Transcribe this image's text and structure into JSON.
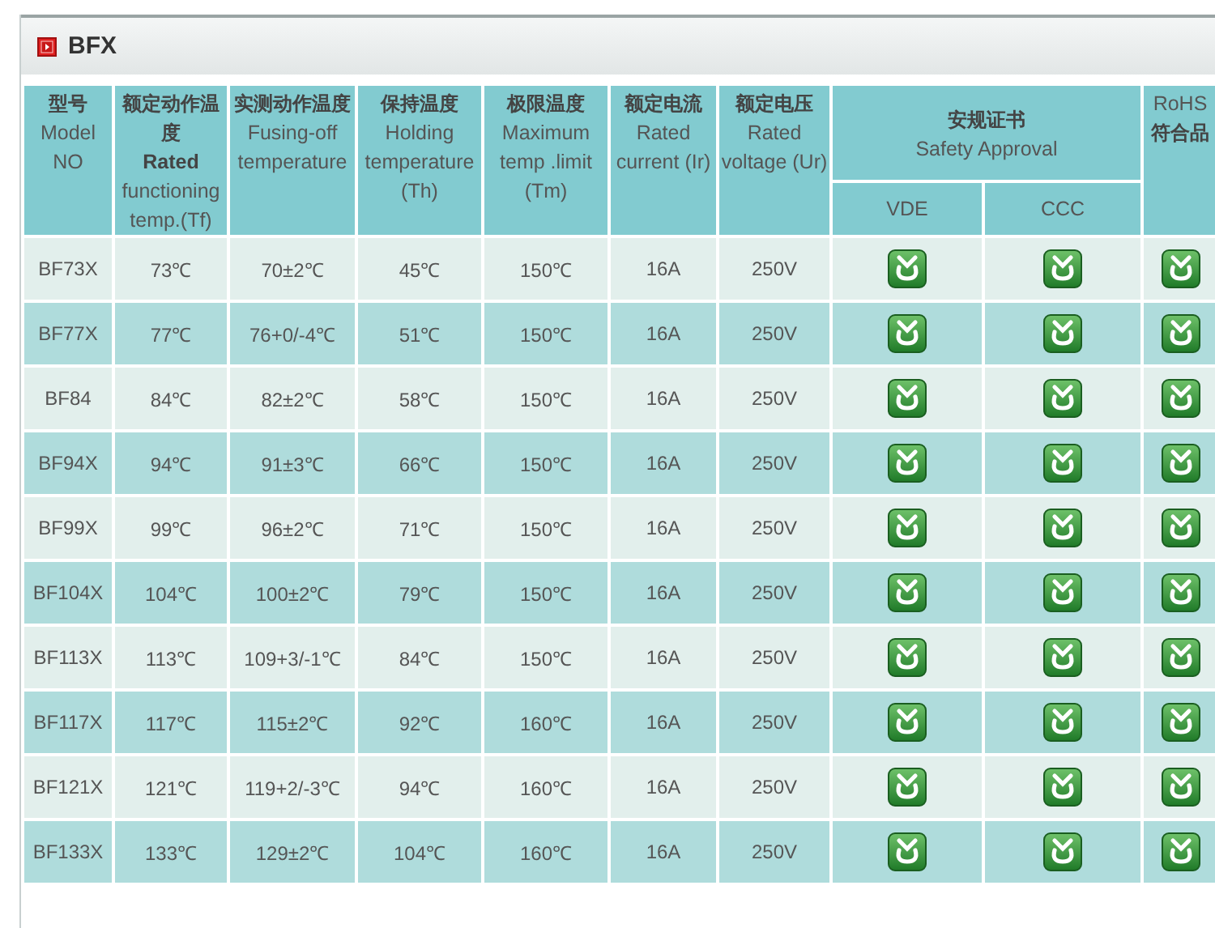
{
  "section": {
    "title": "BFX"
  },
  "columns": [
    {
      "zh": "型号",
      "en": "Model NO"
    },
    {
      "zh": "额定动作温度",
      "en": "**Rated** functioning temp.(Tf)"
    },
    {
      "zh": "实测动作温度",
      "en": "Fusing-off temperature"
    },
    {
      "zh": "保持温度",
      "en": "Holding temperature (Th)"
    },
    {
      "zh": "极限温度",
      "en": "Maximum temp .limit (Tm)"
    },
    {
      "zh": "额定电流",
      "en": "Rated current (Ir)"
    },
    {
      "zh": "额定电压",
      "en": "Rated voltage (Ur)"
    }
  ],
  "approval_group": {
    "zh": "安规证书",
    "en": "Safety Approval",
    "subcolumns": [
      "VDE",
      "CCC"
    ]
  },
  "rohs_column": {
    "en": "RoHS",
    "zh": "符合品"
  },
  "rows": [
    {
      "cells": [
        "BF73X",
        "73℃",
        "70±2℃",
        "45℃",
        "150℃",
        "16A",
        "250V"
      ],
      "vde": true,
      "ccc": true,
      "rohs": true
    },
    {
      "cells": [
        "BF77X",
        "77℃",
        "76+0/-4℃",
        "51℃",
        "150℃",
        "16A",
        "250V"
      ],
      "vde": true,
      "ccc": true,
      "rohs": true
    },
    {
      "cells": [
        "BF84",
        "84℃",
        "82±2℃",
        "58℃",
        "150℃",
        "16A",
        "250V"
      ],
      "vde": true,
      "ccc": true,
      "rohs": true
    },
    {
      "cells": [
        "BF94X",
        "94℃",
        "91±3℃",
        "66℃",
        "150℃",
        "16A",
        "250V"
      ],
      "vde": true,
      "ccc": true,
      "rohs": true
    },
    {
      "cells": [
        "BF99X",
        "99℃",
        "96±2℃",
        "71℃",
        "150℃",
        "16A",
        "250V"
      ],
      "vde": true,
      "ccc": true,
      "rohs": true
    },
    {
      "cells": [
        "BF104X",
        "104℃",
        "100±2℃",
        "79℃",
        "150℃",
        "16A",
        "250V"
      ],
      "vde": true,
      "ccc": true,
      "rohs": true
    },
    {
      "cells": [
        "BF113X",
        "113℃",
        "109+3/-1℃",
        "84℃",
        "150℃",
        "16A",
        "250V"
      ],
      "vde": true,
      "ccc": true,
      "rohs": true
    },
    {
      "cells": [
        "BF117X",
        "117℃",
        "115±2℃",
        "92℃",
        "160℃",
        "16A",
        "250V"
      ],
      "vde": true,
      "ccc": true,
      "rohs": true
    },
    {
      "cells": [
        "BF121X",
        "121℃",
        "119+2/-3℃",
        "94℃",
        "160℃",
        "16A",
        "250V"
      ],
      "vde": true,
      "ccc": true,
      "rohs": true
    },
    {
      "cells": [
        "BF133X",
        "133℃",
        "129±2℃",
        "104℃",
        "160℃",
        "16A",
        "250V"
      ],
      "vde": true,
      "ccc": true,
      "rohs": true
    }
  ]
}
